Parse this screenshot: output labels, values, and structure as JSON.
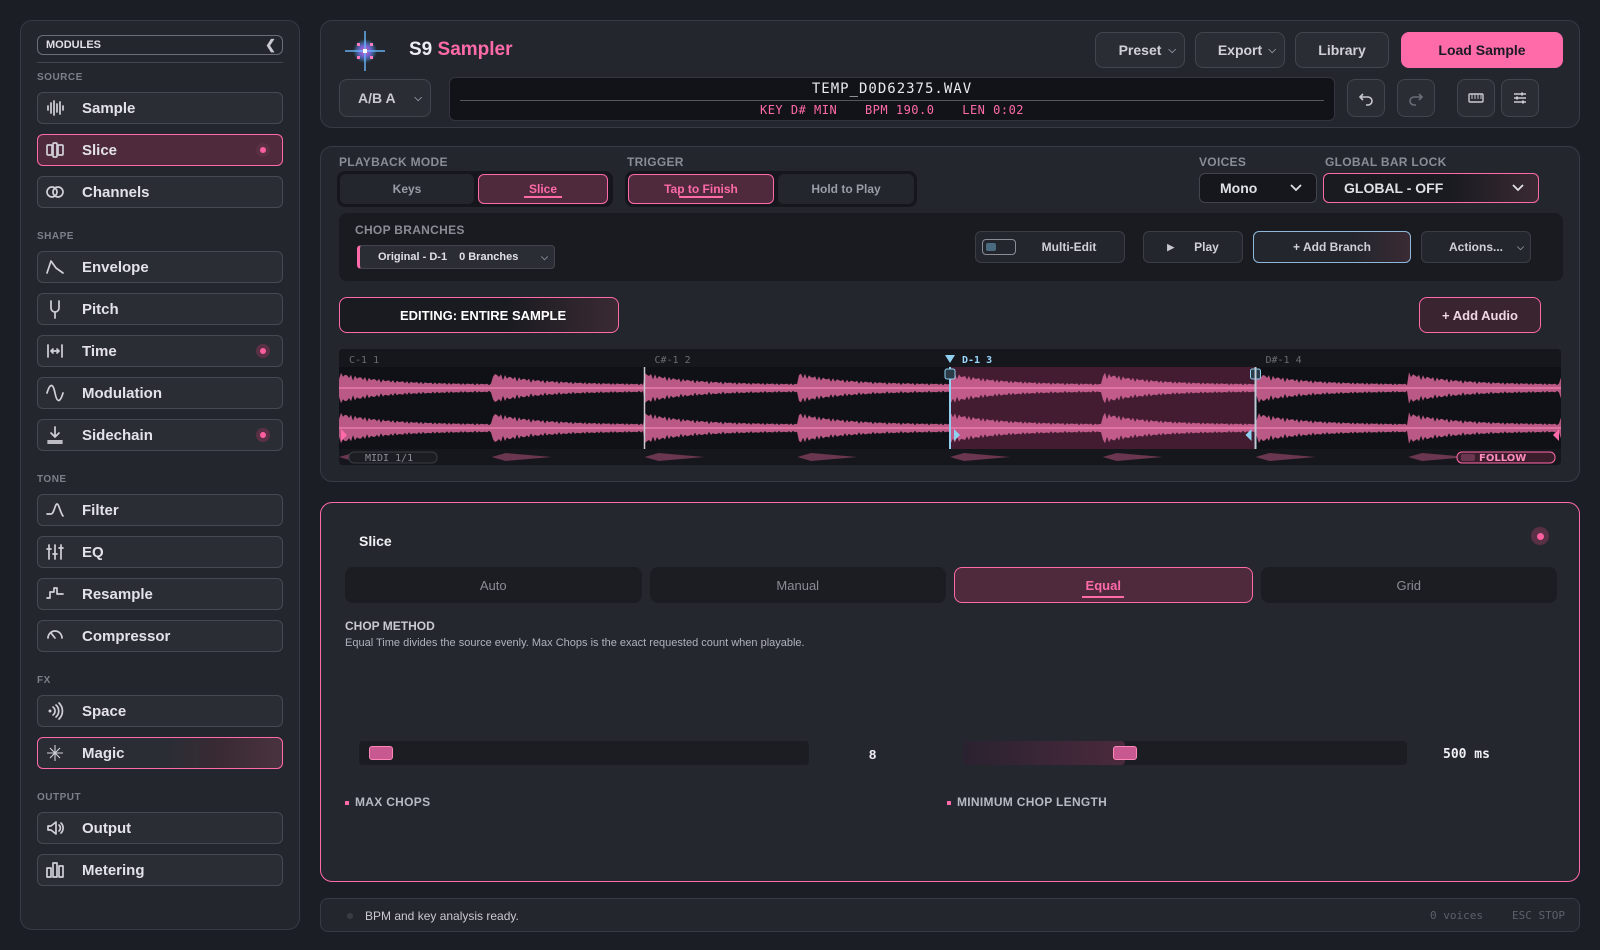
{
  "colors": {
    "accent": "#ff6aa8",
    "bg": "#1c1e25",
    "panel": "#24262e"
  },
  "sidebar": {
    "title": "MODULES",
    "sections": [
      {
        "label": "SOURCE",
        "items": [
          {
            "label": "Sample",
            "icon": "waveform-bars-icon",
            "active": false,
            "dot": false
          },
          {
            "label": "Slice",
            "icon": "slice-icon",
            "active": true,
            "dot": true
          },
          {
            "label": "Channels",
            "icon": "channels-icon",
            "active": false,
            "dot": false
          }
        ]
      },
      {
        "label": "SHAPE",
        "items": [
          {
            "label": "Envelope",
            "icon": "envelope-icon",
            "active": false,
            "dot": false
          },
          {
            "label": "Pitch",
            "icon": "tuning-fork-icon",
            "active": false,
            "dot": false
          },
          {
            "label": "Time",
            "icon": "time-stretch-icon",
            "active": false,
            "dot": true
          },
          {
            "label": "Modulation",
            "icon": "sine-wave-icon",
            "active": false,
            "dot": false
          },
          {
            "label": "Sidechain",
            "icon": "sidechain-icon",
            "active": false,
            "dot": true
          }
        ]
      },
      {
        "label": "TONE",
        "items": [
          {
            "label": "Filter",
            "icon": "filter-curve-icon",
            "active": false,
            "dot": false
          },
          {
            "label": "EQ",
            "icon": "eq-sliders-icon",
            "active": false,
            "dot": false
          },
          {
            "label": "Resample",
            "icon": "resample-icon",
            "active": false,
            "dot": false
          },
          {
            "label": "Compressor",
            "icon": "compressor-gauge-icon",
            "active": false,
            "dot": false
          }
        ]
      },
      {
        "label": "FX",
        "items": [
          {
            "label": "Space",
            "icon": "space-waves-icon",
            "active": false,
            "dot": false
          },
          {
            "label": "Magic",
            "icon": "sparkle-icon",
            "active": false,
            "dot": false,
            "magic": true
          }
        ]
      },
      {
        "label": "OUTPUT",
        "items": [
          {
            "label": "Output",
            "icon": "speaker-icon",
            "active": false,
            "dot": false
          },
          {
            "label": "Metering",
            "icon": "meter-bars-icon",
            "active": false,
            "dot": false
          }
        ]
      }
    ]
  },
  "header": {
    "brand": "S9",
    "product": "Sampler",
    "preset_label": "Preset",
    "export_label": "Export",
    "library_label": "Library",
    "load_label": "Load Sample",
    "ab_label": "A/B A",
    "file_name": "TEMP_D0D62375.WAV",
    "key": "KEY D# MIN",
    "bpm": "BPM 190.0",
    "len": "LEN 0:02"
  },
  "playback": {
    "mode_label": "PLAYBACK MODE",
    "keys_label": "Keys",
    "slice_label": "Slice",
    "trigger_label": "TRIGGER",
    "tap_label": "Tap to Finish",
    "hold_label": "Hold to Play",
    "voices_label": "VOICES",
    "voices_value": "Mono",
    "lock_label": "GLOBAL BAR LOCK",
    "lock_value": "GLOBAL - OFF"
  },
  "chop": {
    "title": "CHOP BRANCHES",
    "branch_name": "Original - D-1",
    "branch_count": "0 Branches",
    "multi_edit": "Multi-Edit",
    "play": "Play",
    "add_branch": "+ Add Branch",
    "actions": "Actions..."
  },
  "editing_label": "EDITING: ENTIRE SAMPLE",
  "add_audio_label": "+ Add Audio",
  "waveform": {
    "markers": [
      "C-1 1",
      "C#-1 2",
      "D-1 3",
      "D#-1 4"
    ],
    "midi_label": "MIDI 1/1",
    "follow_label": "FOLLOW"
  },
  "slice_panel": {
    "title": "Slice",
    "tabs": [
      "Auto",
      "Manual",
      "Equal",
      "Grid"
    ],
    "active_tab": 2,
    "method_title": "CHOP METHOD",
    "method_desc": "Equal Time divides the source evenly. Max Chops is the exact requested count when playable.",
    "max_chops_value": "8",
    "max_chops_label": "MAX CHOPS",
    "max_chops_fraction": 0.0,
    "min_len_value": "500 ms",
    "min_len_label": "MINIMUM CHOP LENGTH",
    "min_len_fraction": 0.35
  },
  "status": {
    "message": "BPM and key analysis ready.",
    "voices": "0 voices",
    "esc": "ESC STOP"
  }
}
